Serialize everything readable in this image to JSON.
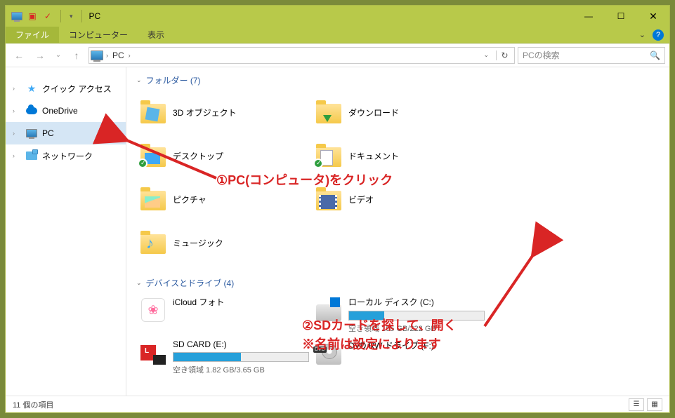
{
  "titlebar": {
    "title": "PC"
  },
  "ribbon": {
    "file": "ファイル",
    "computer": "コンピューター",
    "view": "表示"
  },
  "address": {
    "crumb": "PC",
    "search_placeholder": "PCの検索"
  },
  "sidebar": {
    "items": [
      {
        "label": "クイック アクセス"
      },
      {
        "label": "OneDrive"
      },
      {
        "label": "PC"
      },
      {
        "label": "ネットワーク"
      }
    ]
  },
  "groups": {
    "folders_hdr": "フォルダー (7)",
    "devices_hdr": "デバイスとドライブ (4)"
  },
  "folders": [
    {
      "label": "3D オブジェクト"
    },
    {
      "label": "ダウンロード"
    },
    {
      "label": "デスクトップ"
    },
    {
      "label": "ドキュメント"
    },
    {
      "label": "ピクチャ"
    },
    {
      "label": "ビデオ"
    },
    {
      "label": "ミュージック"
    }
  ],
  "drives": [
    {
      "label": "iCloud フォト"
    },
    {
      "label": "ローカル ディスク (C:)",
      "free": "空き領域 165 GB/222 GB",
      "pct": 26
    },
    {
      "label": "SD CARD (E:)",
      "free": "空き領域 1.82 GB/3.65 GB",
      "pct": 50
    },
    {
      "label": "DVD RW ドライブ (F:)"
    }
  ],
  "status": {
    "count": "11 個の項目"
  },
  "annotations": {
    "a1": "①PC(コンピュータ)をクリック",
    "a2_l1": "②SDカードを探して、開く",
    "a2_l2": "※名前は設定によります"
  }
}
